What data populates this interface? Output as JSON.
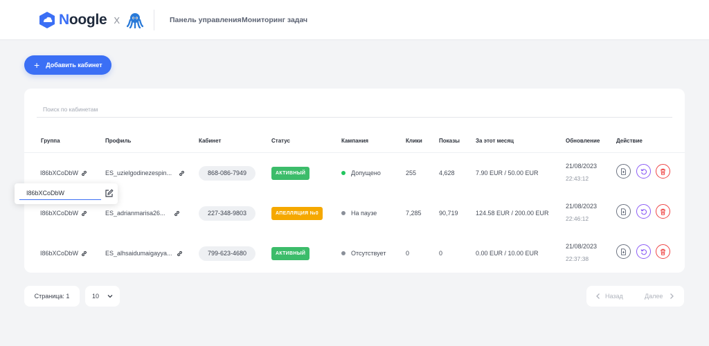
{
  "header": {
    "logo_n": "N",
    "logo_rest": "oogle",
    "logo_x": "X",
    "nav": [
      "Панель управления",
      "Мониторинг задач"
    ]
  },
  "add_button_label": "Добавить кабинет",
  "search": {
    "placeholder": "Поиск по кабинетам"
  },
  "table": {
    "headers": [
      "Группа",
      "Профиль",
      "Кабинет",
      "Статус",
      "Кампания",
      "Клики",
      "Показы",
      "За этот месяц",
      "Обновление",
      "Действие"
    ],
    "rows": [
      {
        "group": "I86bXCoDbW",
        "profile": "ES_uzielgodinezespin...",
        "cabinet": "868-086-7949",
        "status": "АКТИВНЫЙ",
        "status_color": "#3cbc6a",
        "campaign": "Допущено",
        "campaign_dot": "#22c55e",
        "clicks": "255",
        "impressions": "4,628",
        "month": "7.90 EUR / 50.00 EUR",
        "date": "21/08/2023",
        "time": "22:43:12"
      },
      {
        "group": "I86bXCoDbW",
        "profile": "ES_adrianmarisa26...",
        "cabinet": "227-348-9803",
        "status": "АПЕЛЛЯЦИЯ №0",
        "status_color": "#f5a800",
        "campaign": "На паузе",
        "campaign_dot": "#8a8f99",
        "clicks": "7,285",
        "impressions": "90,719",
        "month": "124.58 EUR / 200.00 EUR",
        "date": "21/08/2023",
        "time": "22:46:12"
      },
      {
        "group": "I86bXCoDbW",
        "profile": "ES_alhsaidumaigayya...",
        "cabinet": "799-623-4680",
        "status": "АКТИВНЫЙ",
        "status_color": "#3cbc6a",
        "campaign": "Отсутствует",
        "campaign_dot": "#8a8f99",
        "clicks": "0",
        "impressions": "0",
        "month": "0.00 EUR / 10.00 EUR",
        "date": "21/08/2023",
        "time": "22:37:38"
      }
    ]
  },
  "edit_popup": {
    "value": "I86bXCoDbW"
  },
  "pagination": {
    "page_label": "Страница: 1",
    "page_size": "10",
    "prev_label": "Назад",
    "next_label": "Далее"
  },
  "colors": {
    "accent": "#3b6ff5",
    "active": "#3cbc6a",
    "appeal": "#f5a800",
    "danger": "#ef4444",
    "retry": "#8b5cf6"
  },
  "icons": [
    "noogle-logo-icon",
    "octopus-logo-icon",
    "plus-icon",
    "link-icon",
    "edit-icon",
    "document-icon",
    "retry-icon",
    "trash-icon",
    "chevron-down-icon",
    "chevron-left-icon",
    "chevron-right-icon"
  ]
}
